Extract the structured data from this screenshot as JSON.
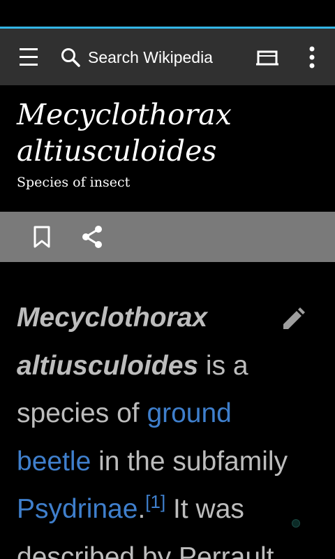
{
  "toolbar": {
    "search_placeholder": "Search Wikipedia",
    "menu_icon": "hamburger-menu-icon",
    "search_icon": "search-icon",
    "tabs_icon": "tabs-icon",
    "overflow_icon": "overflow-menu-icon"
  },
  "article": {
    "title_line1": "Mecyclothorax",
    "title_line2": "altiusculoides",
    "description": "Species of insect"
  },
  "actions": {
    "bookmark_icon": "bookmark-icon",
    "share_icon": "share-icon",
    "edit_icon": "pencil-edit-icon"
  },
  "body": {
    "bold_1": "Mecyclothorax",
    "bold_2": "altiusculoides",
    "text_1": " is a",
    "text_2": "species of ",
    "link_1": "ground",
    "link_2": "beetle",
    "text_3": " in the subfamily",
    "link_3": "Psydrinae",
    "text_4": ".",
    "ref": "[1]",
    "text_5": " It was",
    "text_6": "described by Perrault"
  },
  "colors": {
    "accent": "#33b5e5",
    "toolbar_bg": "#303030",
    "action_bar_bg": "#7a7a7a",
    "link": "#3f7fcc",
    "body_text": "#bdbdbd"
  }
}
